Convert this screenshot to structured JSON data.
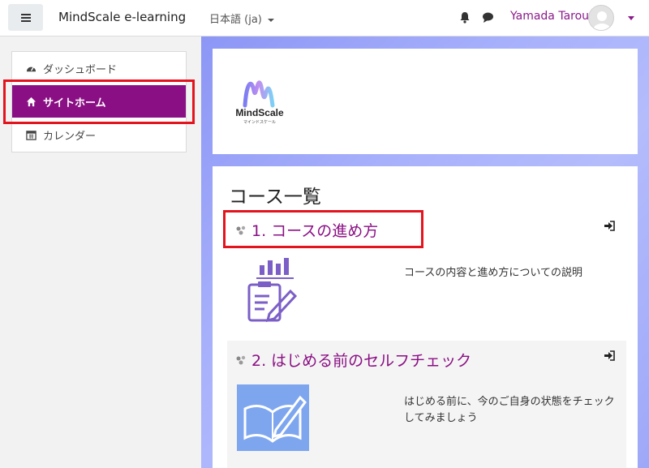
{
  "navbar": {
    "site_name": "MindScale e-learning",
    "language": "日本語 (ja)",
    "user_name": "Yamada Tarou",
    "icons": [
      "menu-icon",
      "bell-icon",
      "chat-icon",
      "avatar"
    ]
  },
  "sidebar": {
    "items": [
      {
        "label": "ダッシュボード",
        "icon": "dashboard-icon"
      },
      {
        "label": "サイトホーム",
        "icon": "home-icon",
        "active": true
      },
      {
        "label": "カレンダー",
        "icon": "calendar-icon"
      }
    ]
  },
  "logo": {
    "name": "MindScale",
    "sub": "マインドスケール"
  },
  "course_list": {
    "title": "コース一覧",
    "courses": [
      {
        "title": "1. コースの進め方",
        "summary": "コースの内容と進め方についての説明"
      },
      {
        "title": "2. はじめる前のセルフチェック",
        "summary": "はじめる前に、今のご自身の状態をチェックしてみましょう"
      }
    ]
  },
  "colors": {
    "accent": "#8a0f84",
    "highlight": "#e3141e"
  }
}
